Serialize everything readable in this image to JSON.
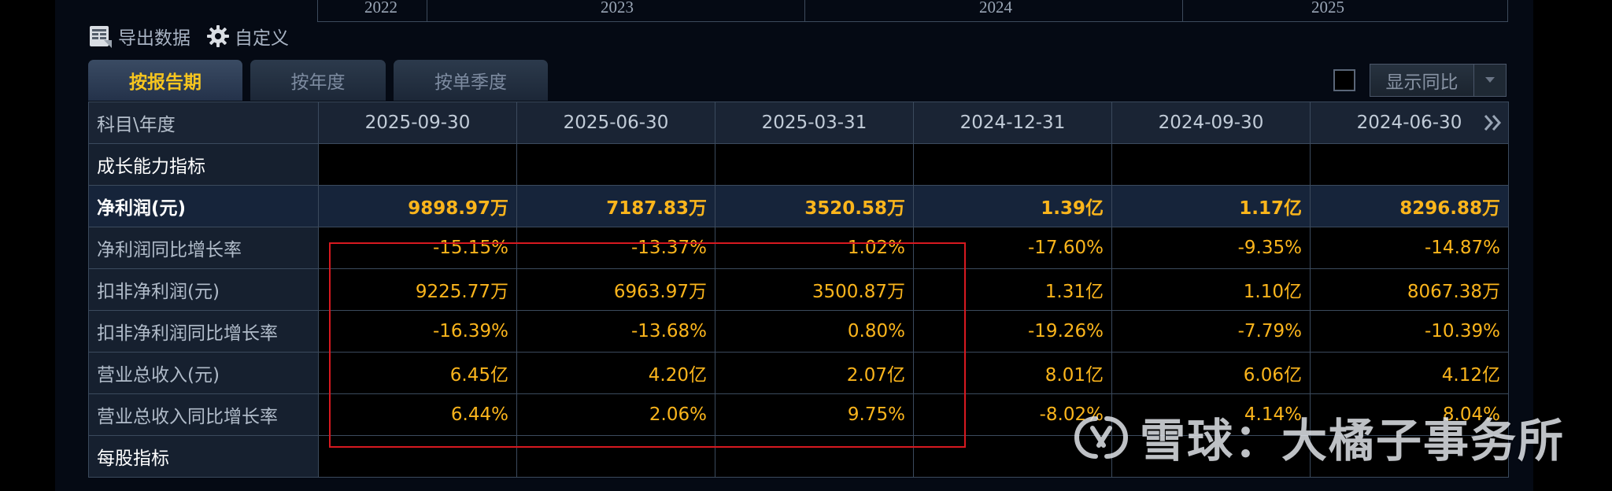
{
  "timeline": {
    "years": [
      "2022",
      "2023",
      "2024",
      "2025"
    ]
  },
  "toolbar": {
    "export_label": "导出数据",
    "customize_label": "自定义"
  },
  "tabs": [
    {
      "label": "按报告期",
      "active": true
    },
    {
      "label": "按年度",
      "active": false
    },
    {
      "label": "按单季度",
      "active": false
    }
  ],
  "yoy": {
    "checked": false,
    "label": "显示同比"
  },
  "table": {
    "header_label": "科目\\年度",
    "columns": [
      "2025-09-30",
      "2025-06-30",
      "2025-03-31",
      "2024-12-31",
      "2024-09-30",
      "2024-06-30"
    ],
    "rows": [
      {
        "label": "成长能力指标",
        "type": "section",
        "values": [
          "",
          "",
          "",
          "",
          "",
          ""
        ]
      },
      {
        "label": "净利润(元)",
        "type": "strong",
        "values": [
          "9898.97万",
          "7187.83万",
          "3520.58万",
          "1.39亿",
          "1.17亿",
          "8296.88万"
        ]
      },
      {
        "label": "净利润同比增长率",
        "type": "normal",
        "values": [
          "-15.15%",
          "-13.37%",
          "1.02%",
          "-17.60%",
          "-9.35%",
          "-14.87%"
        ]
      },
      {
        "label": "扣非净利润(元)",
        "type": "normal",
        "values": [
          "9225.77万",
          "6963.97万",
          "3500.87万",
          "1.31亿",
          "1.10亿",
          "8067.38万"
        ]
      },
      {
        "label": "扣非净利润同比增长率",
        "type": "normal",
        "values": [
          "-16.39%",
          "-13.68%",
          "0.80%",
          "-19.26%",
          "-7.79%",
          "-10.39%"
        ]
      },
      {
        "label": "营业总收入(元)",
        "type": "normal",
        "values": [
          "6.45亿",
          "4.20亿",
          "2.07亿",
          "8.01亿",
          "6.06亿",
          "4.12亿"
        ]
      },
      {
        "label": "营业总收入同比增长率",
        "type": "normal",
        "values": [
          "6.44%",
          "2.06%",
          "9.75%",
          "-8.02%",
          "4.14%",
          "8.04%"
        ]
      },
      {
        "label": "每股指标",
        "type": "section",
        "values": [
          "",
          "",
          "",
          "",
          "",
          ""
        ]
      }
    ]
  },
  "watermark": {
    "text": "雪球：大橘子事务所"
  },
  "colors": {
    "value": "#fbb51c",
    "active_tab": "#f6c51f",
    "highlight": "#d71920"
  }
}
